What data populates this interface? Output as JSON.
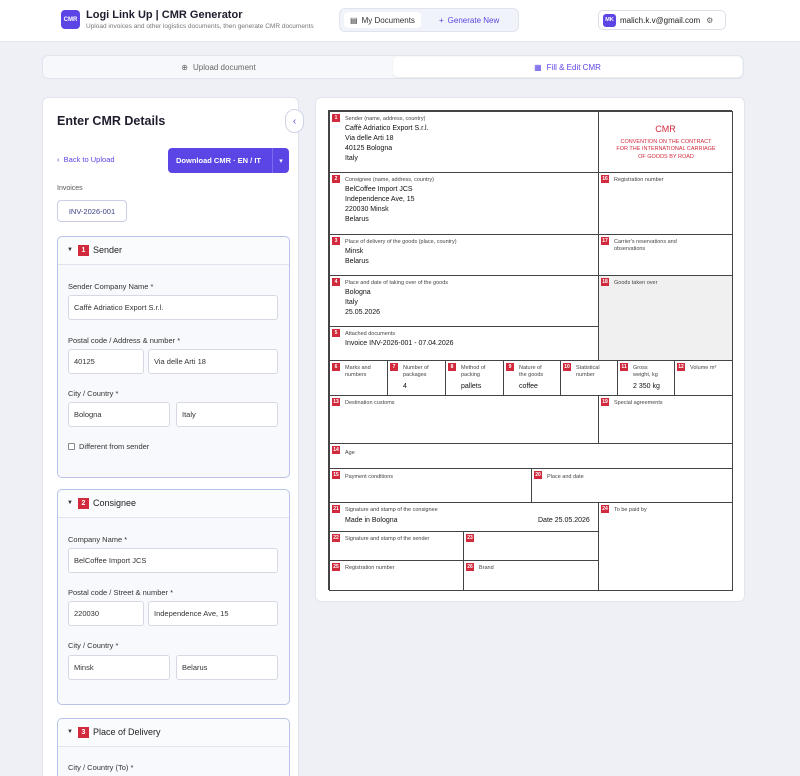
{
  "header": {
    "logo": "CMR",
    "title": "Logi Link Up | CMR Generator",
    "subtitle": "Upload invoices and other logistics documents, then generate CMR documents",
    "nav": {
      "docs_label": "My Documents",
      "new_label": "Generate New"
    },
    "user": {
      "initials": "MK",
      "email": "malich.k.v@gmail.com"
    }
  },
  "steps": {
    "upload": "Upload document",
    "fill": "Fill & Edit CMR"
  },
  "left": {
    "title": "Enter CMR Details",
    "back": "Back to Upload",
    "download": "Download CMR · EN / IT",
    "invoices_label": "Invoices",
    "invoice": "INV-2026-001",
    "sender": {
      "num": "1",
      "title": "Sender",
      "company_label": "Sender Company Name *",
      "company": "Caffè Adriatico Export S.r.l.",
      "addr_label": "Postal code / Address & number *",
      "postal": "40125",
      "street": "Via delle Arti 18",
      "city_label": "City / Country *",
      "city": "Bologna",
      "country": "Italy",
      "different": "Different from sender"
    },
    "consignee": {
      "num": "2",
      "title": "Consignee",
      "company_label": "Company Name *",
      "company": "BelCoffee Import JCS",
      "addr_label": "Postal code / Street & number *",
      "postal": "220030",
      "street": "Independence Ave, 15",
      "city_label": "City / Country *",
      "city": "Minsk",
      "country": "Belarus"
    },
    "delivery": {
      "num": "3",
      "title": "Place of Delivery",
      "city_label": "City / Country (To) *"
    }
  },
  "cmr": {
    "c1": {
      "num": "1",
      "label": "Sender (name, address, country)",
      "value": "Caffè Adriatico Export S.r.l.\nVia delle Arti 18\n40125 Bologna\nItaly"
    },
    "head": {
      "title": "CMR",
      "sub": "CONVENTION ON THE CONTRACT\nFOR THE INTERNATIONAL CARRIAGE\nOF GOODS BY ROAD"
    },
    "c2": {
      "num": "2",
      "label": "Consignee (name, address, country)",
      "value": "BelCoffee Import JCS\nIndependence Ave, 15\n220030 Minsk\nBelarus"
    },
    "c16": {
      "num": "16",
      "label": "Registration number"
    },
    "c3": {
      "num": "3",
      "label": "Place of delivery of the goods (place, country)",
      "value": "Minsk\nBelarus"
    },
    "c17": {
      "num": "17",
      "label": "Carrier's reservations and\nobservations"
    },
    "c4": {
      "num": "4",
      "label": "Place and date of taking over of the goods",
      "value": "Bologna\nItaly\n25.05.2026"
    },
    "c18": {
      "num": "18",
      "label": "Goods taken over"
    },
    "c5": {
      "num": "5",
      "label": "Attached documents",
      "value": "Invoice INV-2026-001 - 07.04.2026"
    },
    "c6": {
      "num": "6",
      "label": "Marks and\nnumbers"
    },
    "c7": {
      "num": "7",
      "label": "Number of\npackages",
      "value": "4"
    },
    "c8": {
      "num": "8",
      "label": "Method of\npacking",
      "value": "pallets"
    },
    "c9": {
      "num": "9",
      "label": "Nature of\nthe goods",
      "value": "coffee"
    },
    "c10": {
      "num": "10",
      "label": "Statistical\nnumber"
    },
    "c11": {
      "num": "11",
      "label": "Gross\nweight, kg",
      "value": "2 350 kg"
    },
    "c12": {
      "num": "12",
      "label": "Volume m³"
    },
    "c13": {
      "num": "13",
      "label": "Destination customs"
    },
    "c19": {
      "num": "19",
      "label": "Special agreements"
    },
    "c14": {
      "num": "14",
      "label": "Age"
    },
    "c15": {
      "num": "15",
      "label": "Payment conditions"
    },
    "c20": {
      "num": "20",
      "label": "Place and date"
    },
    "c21": {
      "num": "21",
      "label": "Signature and stamp of the consignee",
      "value": "Made in Bologna",
      "date": "Date 25.05.2026"
    },
    "c24": {
      "num": "24",
      "label": "To be paid by"
    },
    "c22": {
      "num": "22",
      "label": "Signature and stamp of the sender"
    },
    "c23": {
      "num": "23"
    },
    "c25": {
      "num": "25",
      "label": "Registration number"
    },
    "c26": {
      "num": "26",
      "label": "Brand"
    }
  }
}
